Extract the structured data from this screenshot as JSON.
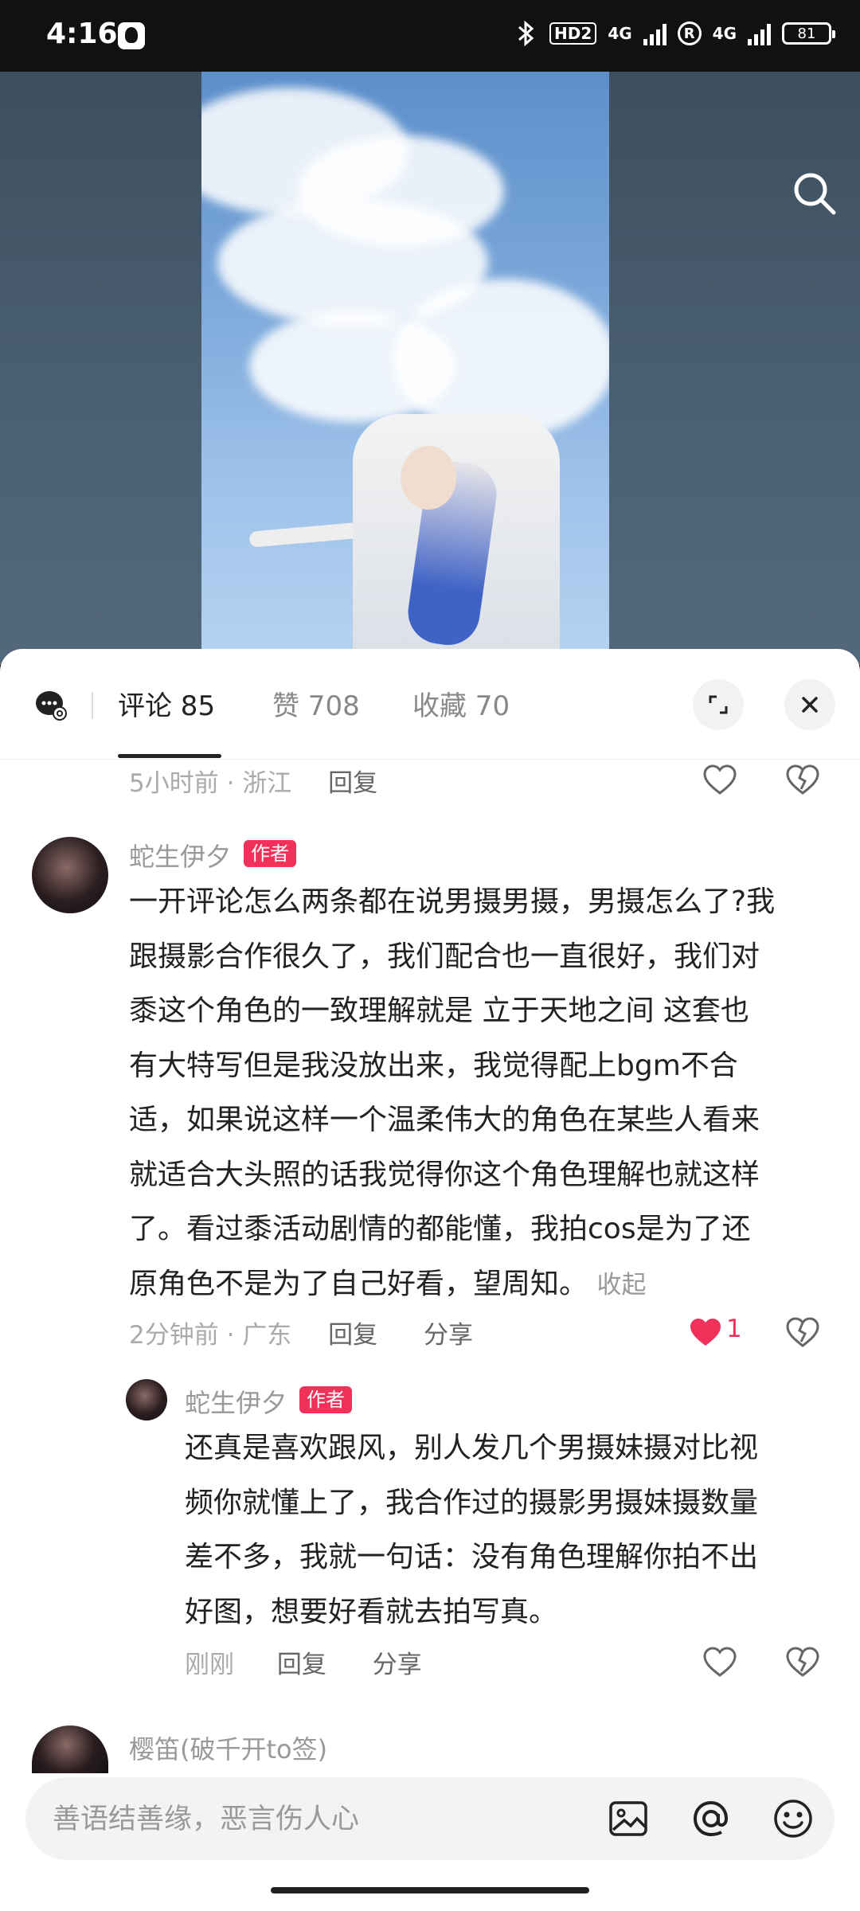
{
  "status_bar": {
    "time": "4:16",
    "hd_label": "HD2",
    "net1": "4G",
    "net2": "4G",
    "roaming": "R",
    "battery": "81"
  },
  "tabs": [
    {
      "label": "评论 85",
      "active": true
    },
    {
      "label": "赞 708",
      "active": false
    },
    {
      "label": "收藏 70",
      "active": false
    }
  ],
  "comments": {
    "prev_meta": {
      "time": "5小时前",
      "location": "浙江",
      "reply": "回复"
    },
    "main": {
      "name": "蛇生伊夕",
      "badge": "作者",
      "lines": [
        "一开评论怎么两条都在说男摄男摄，男摄怎么了?我",
        "跟摄影合作很久了，我们配合也一直很好，我们对",
        "黍这个角色的一致理解就是 立于天地之间 这套也",
        "有大特写但是我没放出来，我觉得配上bgm不合",
        "适，如果说这样一个温柔伟大的角色在某些人看来",
        "就适合大头照的话我觉得你这个角色理解也就这样",
        "了。看过黍活动剧情的都能懂，我拍cos是为了还",
        "原角色不是为了自己好看，望周知。"
      ],
      "collapse": "收起",
      "time": "2分钟前",
      "location": "广东",
      "reply": "回复",
      "share": "分享",
      "likes": "1"
    },
    "reply": {
      "name": "蛇生伊夕",
      "badge": "作者",
      "lines": [
        "还真是喜欢跟风，别人发几个男摄妹摄对比视",
        "频你就懂上了，我合作过的摄影男摄妹摄数量",
        "差不多，我就一句话：没有角色理解你拍不出",
        "好图，想要好看就去拍写真。"
      ],
      "time": "刚刚",
      "reply": "回复",
      "share": "分享"
    },
    "next": {
      "name": "樱笛(破千开to签)"
    }
  },
  "input": {
    "placeholder": "善语结善缘，恶言伤人心"
  },
  "colors": {
    "badge": "#f0325b",
    "like": "#f0325b",
    "text": "#222222",
    "meta": "#999999"
  }
}
